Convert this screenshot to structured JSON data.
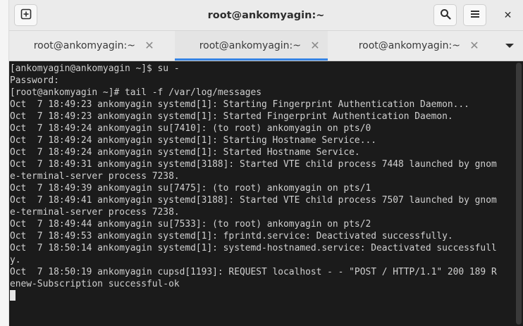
{
  "window": {
    "title": "root@ankomyagin:~"
  },
  "headerbar": {
    "new_tab_icon": "new-tab-icon",
    "search_icon": "search-icon",
    "menu_icon": "hamburger-menu-icon",
    "close_icon": "close-icon",
    "close_glyph": "✕"
  },
  "tabs": [
    {
      "label": "root@ankomyagin:~",
      "close": "✕",
      "active": false
    },
    {
      "label": "root@ankomyagin:~",
      "close": "✕",
      "active": true
    },
    {
      "label": "root@ankomyagin:~",
      "close": "✕",
      "active": false
    }
  ],
  "colors": {
    "accent": "#3584e4",
    "terminal_bg": "#1b1b1b",
    "terminal_fg": "#d0d0d0",
    "headerbar_bg": "#ebebeb"
  },
  "terminal": {
    "lines": [
      "[ankomyagin@ankomyagin ~]$ su -",
      "Password:",
      "[root@ankomyagin ~]# tail -f /var/log/messages",
      "Oct  7 18:49:23 ankomyagin systemd[1]: Starting Fingerprint Authentication Daemon...",
      "Oct  7 18:49:23 ankomyagin systemd[1]: Started Fingerprint Authentication Daemon.",
      "Oct  7 18:49:24 ankomyagin su[7410]: (to root) ankomyagin on pts/0",
      "Oct  7 18:49:24 ankomyagin systemd[1]: Starting Hostname Service...",
      "Oct  7 18:49:24 ankomyagin systemd[1]: Started Hostname Service.",
      "Oct  7 18:49:31 ankomyagin systemd[3188]: Started VTE child process 7448 launched by gnom",
      "e-terminal-server process 7238.",
      "Oct  7 18:49:39 ankomyagin su[7475]: (to root) ankomyagin on pts/1",
      "Oct  7 18:49:41 ankomyagin systemd[3188]: Started VTE child process 7507 launched by gnom",
      "e-terminal-server process 7238.",
      "Oct  7 18:49:44 ankomyagin su[7533]: (to root) ankomyagin on pts/2",
      "Oct  7 18:49:53 ankomyagin systemd[1]: fprintd.service: Deactivated successfully.",
      "Oct  7 18:50:14 ankomyagin systemd[1]: systemd-hostnamed.service: Deactivated successfull",
      "y.",
      "Oct  7 18:50:19 ankomyagin cupsd[1193]: REQUEST localhost - - \"POST / HTTP/1.1\" 200 189 R",
      "enew-Subscription successful-ok"
    ]
  }
}
